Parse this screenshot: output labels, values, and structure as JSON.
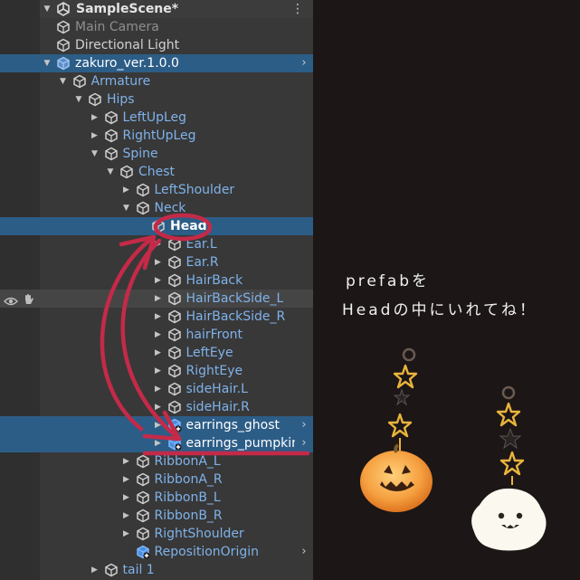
{
  "scene": {
    "name": "SampleScene*",
    "menu_icon": "kebab-menu-icon",
    "scene_icon": "unity-logo-icon"
  },
  "hierarchy": [
    {
      "label": "Main Camera",
      "indent": 0,
      "arrow": "",
      "style": "dim",
      "icon": "gameobject-cube-icon"
    },
    {
      "label": "Directional Light",
      "indent": 0,
      "arrow": "",
      "style": "",
      "icon": "gameobject-cube-icon"
    },
    {
      "label": "zakuro_ver.1.0.0",
      "indent": 0,
      "arrow": "expanded",
      "style": "white",
      "icon": "prefab-cube-icon",
      "selected": true,
      "chevron": true
    },
    {
      "label": "Armature",
      "indent": 1,
      "arrow": "expanded",
      "style": "blue",
      "icon": "gameobject-cube-icon"
    },
    {
      "label": "Hips",
      "indent": 2,
      "arrow": "expanded",
      "style": "blue",
      "icon": "gameobject-cube-icon"
    },
    {
      "label": "LeftUpLeg",
      "indent": 3,
      "arrow": "collapsed",
      "style": "blue",
      "icon": "gameobject-cube-icon"
    },
    {
      "label": "RightUpLeg",
      "indent": 3,
      "arrow": "collapsed",
      "style": "blue",
      "icon": "gameobject-cube-icon"
    },
    {
      "label": "Spine",
      "indent": 3,
      "arrow": "expanded",
      "style": "blue",
      "icon": "gameobject-cube-icon"
    },
    {
      "label": "Chest",
      "indent": 4,
      "arrow": "expanded",
      "style": "blue",
      "icon": "gameobject-cube-icon"
    },
    {
      "label": "LeftShoulder",
      "indent": 5,
      "arrow": "collapsed",
      "style": "blue",
      "icon": "gameobject-cube-icon"
    },
    {
      "label": "Neck",
      "indent": 5,
      "arrow": "expanded",
      "style": "blue",
      "icon": "gameobject-cube-icon"
    },
    {
      "label": "Head",
      "indent": 6,
      "arrow": "",
      "style": "white",
      "icon": "gameobject-cube-icon",
      "selected": true
    },
    {
      "label": "Ear.L",
      "indent": 7,
      "arrow": "collapsed",
      "style": "blue",
      "icon": "gameobject-cube-icon"
    },
    {
      "label": "Ear.R",
      "indent": 7,
      "arrow": "collapsed",
      "style": "blue",
      "icon": "gameobject-cube-icon"
    },
    {
      "label": "HairBack",
      "indent": 7,
      "arrow": "collapsed",
      "style": "blue",
      "icon": "gameobject-cube-icon"
    },
    {
      "label": "HairBackSide_L",
      "indent": 7,
      "arrow": "collapsed",
      "style": "blue",
      "icon": "gameobject-cube-icon",
      "hover": true,
      "gutter_icons": true
    },
    {
      "label": "HairBackSide_R",
      "indent": 7,
      "arrow": "collapsed",
      "style": "blue",
      "icon": "gameobject-cube-icon"
    },
    {
      "label": "hairFront",
      "indent": 7,
      "arrow": "collapsed",
      "style": "blue",
      "icon": "gameobject-cube-icon"
    },
    {
      "label": "LeftEye",
      "indent": 7,
      "arrow": "collapsed",
      "style": "blue",
      "icon": "gameobject-cube-icon"
    },
    {
      "label": "RightEye",
      "indent": 7,
      "arrow": "collapsed",
      "style": "blue",
      "icon": "gameobject-cube-icon"
    },
    {
      "label": "sideHair.L",
      "indent": 7,
      "arrow": "collapsed",
      "style": "blue",
      "icon": "gameobject-cube-icon"
    },
    {
      "label": "sideHair.R",
      "indent": 7,
      "arrow": "collapsed",
      "style": "blue",
      "icon": "gameobject-cube-icon"
    },
    {
      "label": "earrings_ghost",
      "indent": 7,
      "arrow": "collapsed",
      "style": "white",
      "icon": "prefab-added-cube-icon",
      "selected": true,
      "chevron": true
    },
    {
      "label": "earrings_pumpkin",
      "indent": 7,
      "arrow": "collapsed",
      "style": "white",
      "icon": "prefab-added-cube-icon",
      "selected": true,
      "chevron": true
    },
    {
      "label": "RibbonA_L",
      "indent": 5,
      "arrow": "collapsed",
      "style": "blue",
      "icon": "gameobject-cube-icon"
    },
    {
      "label": "RibbonA_R",
      "indent": 5,
      "arrow": "collapsed",
      "style": "blue",
      "icon": "gameobject-cube-icon"
    },
    {
      "label": "RibbonB_L",
      "indent": 5,
      "arrow": "collapsed",
      "style": "blue",
      "icon": "gameobject-cube-icon"
    },
    {
      "label": "RibbonB_R",
      "indent": 5,
      "arrow": "collapsed",
      "style": "blue",
      "icon": "gameobject-cube-icon"
    },
    {
      "label": "RightShoulder",
      "indent": 5,
      "arrow": "collapsed",
      "style": "blue",
      "icon": "gameobject-cube-icon"
    },
    {
      "label": "RepositionOrigin",
      "indent": 5,
      "arrow": "",
      "style": "blue",
      "icon": "prefab-added-cube-icon",
      "chevron": true
    },
    {
      "label": "tail 1",
      "indent": 3,
      "arrow": "collapsed",
      "style": "blue",
      "icon": "gameobject-cube-icon"
    }
  ],
  "annotation": {
    "line1": "prefabを",
    "line2": "Headの中にいれてね！"
  },
  "accessories": [
    {
      "name": "pumpkin-earring"
    },
    {
      "name": "ghost-earring"
    }
  ],
  "colors": {
    "selection": "#2c5d87",
    "annotation_red": "#c42a48",
    "background_dark": "#1c1616",
    "pumpkin": "#f2a044",
    "star_gold": "#e8b038"
  }
}
